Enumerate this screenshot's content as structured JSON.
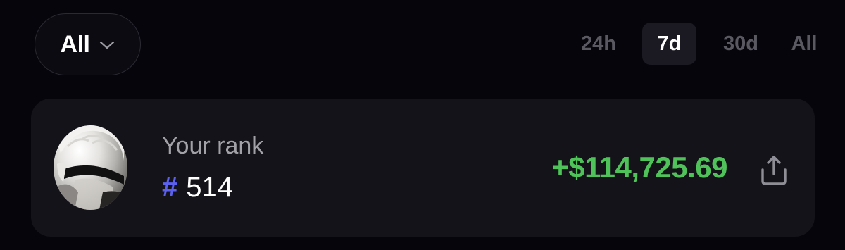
{
  "filter": {
    "label": "All",
    "icon": "chevron-down-icon"
  },
  "period_tabs": [
    {
      "label": "24h",
      "active": false
    },
    {
      "label": "7d",
      "active": true
    },
    {
      "label": "30d",
      "active": false
    },
    {
      "label": "All",
      "active": false
    }
  ],
  "rank_card": {
    "label": "Your rank",
    "hash": "#",
    "rank": "514",
    "pnl": "+$114,725.69",
    "share_icon": "share-icon"
  },
  "colors": {
    "background": "#06050b",
    "card": "#141319",
    "active_tab": "#1b1a22",
    "inactive_text": "#5a5962",
    "muted_text": "#a2a1a8",
    "accent_hash": "#5b60ee",
    "positive": "#4fc259"
  }
}
